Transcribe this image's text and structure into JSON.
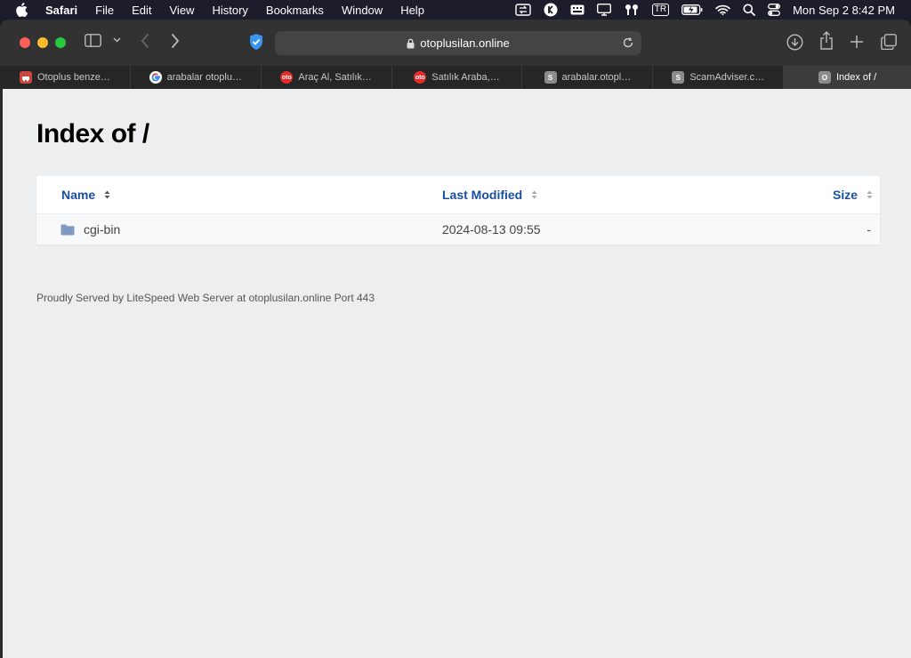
{
  "menubar": {
    "app_name": "Safari",
    "menus": [
      "File",
      "Edit",
      "View",
      "History",
      "Bookmarks",
      "Window",
      "Help"
    ],
    "input_source": "TR",
    "clock": "Mon Sep 2  8:42 PM"
  },
  "browser": {
    "address": "otoplusilan.online",
    "tabs": [
      {
        "label": "Otoplus benze…",
        "favicon": "otoplus"
      },
      {
        "label": "arabalar otoplu…",
        "favicon": "google"
      },
      {
        "label": "Araç Al, Satılık…",
        "favicon": "oto"
      },
      {
        "label": "Satılık Araba,…",
        "favicon": "oto"
      },
      {
        "label": "arabalar.otopl…",
        "favicon": "S"
      },
      {
        "label": "ScamAdviser.c…",
        "favicon": "S"
      },
      {
        "label": "Index of /",
        "favicon": "O",
        "active": true
      }
    ],
    "oto_favicon_text": "oto"
  },
  "page": {
    "title": "Index of /",
    "columns": {
      "name": "Name",
      "modified": "Last Modified",
      "size": "Size"
    },
    "rows": [
      {
        "name": "cgi-bin",
        "modified": "2024-08-13 09:55",
        "size": "-",
        "type": "folder"
      }
    ],
    "footer": "Proudly Served by LiteSpeed Web Server at otoplusilan.online Port 443"
  },
  "colors": {
    "header_link": "#1a4fa0",
    "page_bg": "#eceef0",
    "folder_icon": "#7f9ac2"
  }
}
